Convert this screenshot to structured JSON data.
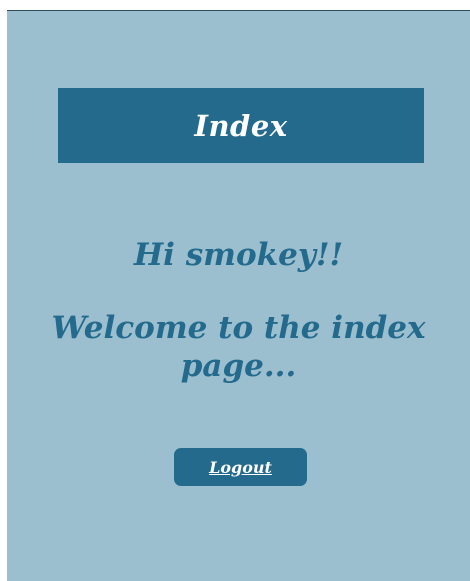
{
  "header": {
    "title": "Index"
  },
  "content": {
    "greeting": "Hi smokey!!",
    "welcome": "Welcome to the index page..."
  },
  "actions": {
    "logout_label": "Logout"
  },
  "colors": {
    "background": "#9bbfcf",
    "accent": "#236a8d",
    "text_on_accent": "#ffffff"
  }
}
